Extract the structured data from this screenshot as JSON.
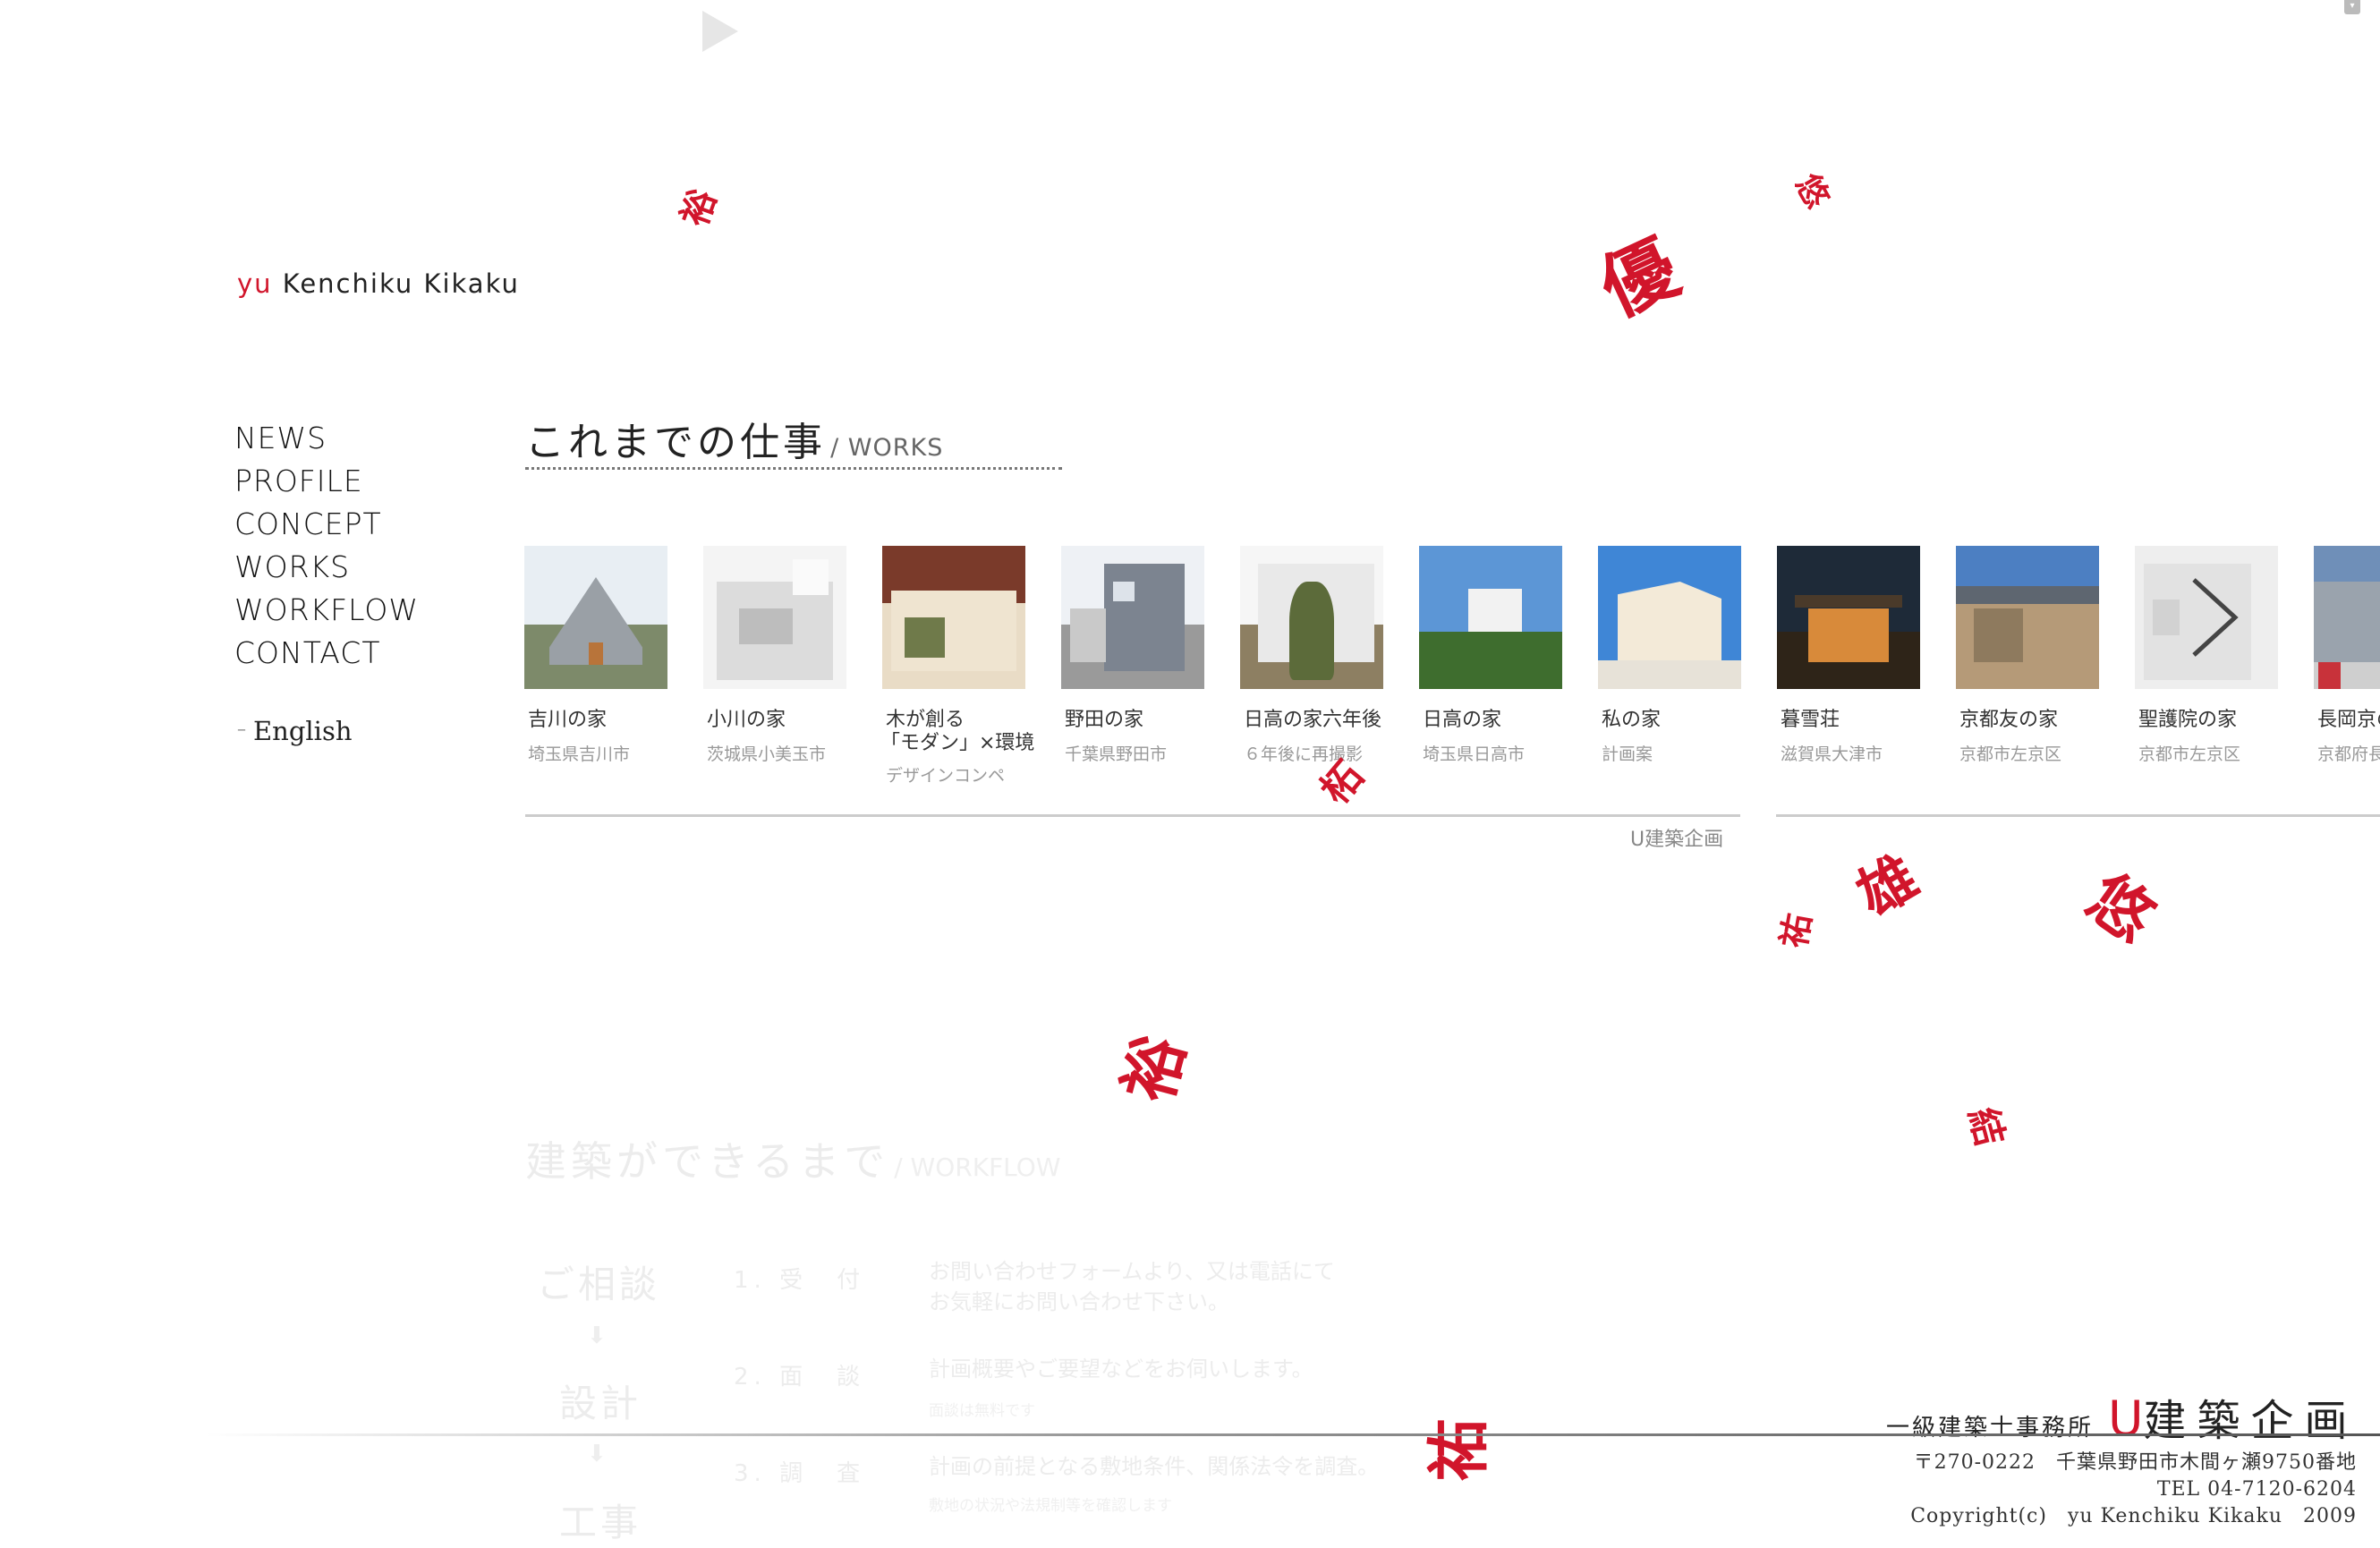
{
  "colors": {
    "accent": "#d1152b",
    "text": "#222222",
    "muted": "#999999",
    "faded": "#ececec"
  },
  "logo": {
    "prefix": "yu",
    "name": "Kenchiku Kikaku"
  },
  "nav": {
    "items": [
      "NEWS",
      "PROFILE",
      "CONCEPT",
      "WORKS",
      "WORKFLOW",
      "CONTACT"
    ],
    "english": "English"
  },
  "works": {
    "title_jp": "これまでの仕事",
    "title_en": "/ WORKS",
    "credit": "U建築企画",
    "items": [
      {
        "title": "吉川の家",
        "sub": "埼玉県吉川市"
      },
      {
        "title": "小川の家",
        "sub": "茨城県小美玉市"
      },
      {
        "title": "木が創る",
        "title2": "「モダン」×環境",
        "sub": "デザインコンペ"
      },
      {
        "title": "野田の家",
        "sub": "千葉県野田市"
      },
      {
        "title": "日高の家六年後",
        "sub": "６年後に再撮影"
      },
      {
        "title": "日高の家",
        "sub": "埼玉県日高市"
      },
      {
        "title": "私の家",
        "sub": "計画案"
      },
      {
        "title": "暮雪荘",
        "sub": "滋賀県大津市"
      },
      {
        "title": "京都友の家",
        "sub": "京都市左京区"
      },
      {
        "title": "聖護院の家",
        "sub": "京都市左京区"
      },
      {
        "title": "長岡京の",
        "sub": "京都府長"
      }
    ]
  },
  "workflow": {
    "title_jp": "建築ができるまで",
    "title_en": "/ WORKFLOW",
    "phases": [
      "ご相談",
      "設計",
      "工事"
    ],
    "steps": [
      {
        "num": "1.",
        "label": "受　付",
        "desc": "お問い合わせフォームより、又は電話にて",
        "desc2": "お気軽にお問い合わせ下さい。"
      },
      {
        "num": "2.",
        "label": "面　談",
        "desc": "計画概要やご要望などをお伺いします。",
        "note": "面談は無料です"
      },
      {
        "num": "3.",
        "label": "調　査",
        "desc": "計画の前提となる敷地条件、関係法令を調査。",
        "note": "敷地の状況や法規制等を確認します"
      }
    ]
  },
  "floating_kanji": [
    "裕",
    "優",
    "悠",
    "柘",
    "雄",
    "祐",
    "悠",
    "裕",
    "結",
    "祐"
  ],
  "footer": {
    "office_prefix": "一級建築士事務所",
    "office_u": "U",
    "office_name": "建築企画",
    "address": "〒270-0222　千葉県野田市木間ヶ瀬9750番地",
    "tel": "TEL 04-7120-6204",
    "copyright": "Copyright(c)　yu Kenchiku Kikaku　2009"
  }
}
